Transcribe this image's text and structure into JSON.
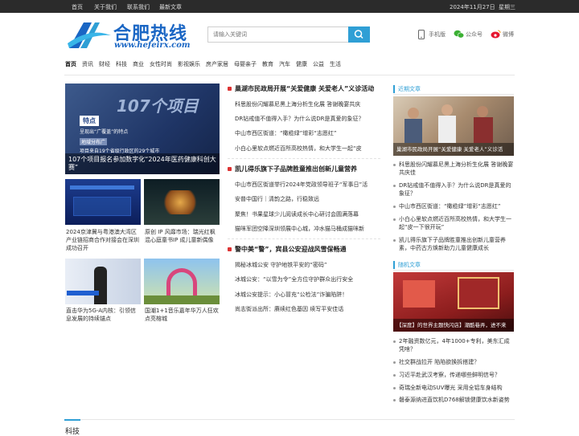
{
  "topbar": {
    "links": [
      "首页",
      "关于我们",
      "联系我们",
      "最新文章"
    ],
    "date": "2024年11月27日",
    "weekday": "星期三"
  },
  "header": {
    "logo_text": "合肥热线",
    "logo_url": "www.hefeirx.com",
    "search_placeholder": "请输入关键词",
    "mobile_label": "手机版",
    "wechat_label": "公众号",
    "weibo_label": "微博"
  },
  "nav": [
    "首页",
    "资讯",
    "财经",
    "科技",
    "商业",
    "女性时尚",
    "影视娱乐",
    "房产家居",
    "母婴亲子",
    "教育",
    "汽车",
    "健康",
    "公益",
    "生活"
  ],
  "featured": {
    "banner_big_text": "107个项目",
    "banner_box_title": "特点",
    "banner_box_sub": "呈现出“广覆盖”的特点",
    "banner_line1": "地域分布广",
    "banner_line2": "项目来自19个省级行政区的29个城市",
    "caption": "107个项目报名参加数字化“2024年医药健康科创大赛”"
  },
  "thumbs": [
    {
      "caption": "2024京津冀与粤港澳大湾区产业链招商合作对接会在深圳成功召开"
    },
    {
      "caption": "原创 IP 风靡市场：瑞光红枫混心庭童书IP 成儿童新偶像"
    },
    {
      "caption": "直击华为5G-A内核：引领信息发展的持续锚点"
    },
    {
      "caption": "国潮1+1音乐嘉年华万人狂欢点亮榕城"
    }
  ],
  "middle": [
    {
      "headline": "巢湖市民政局开展“关爱健康 关爱老人”义诊活动",
      "items": [
        "科思股份闪耀慕尼黑上海分析生化展 答谢晚宴共庆",
        "DR钻戒值不值得入手？为什么说DR是真爱的象征？",
        "中山市西区街道：“橄榄绿”增彩“志愿红”",
        "小白心里软点燃近百所高校热情，和大学生一起“皮"
      ]
    },
    {
      "headline": "凯儿得乐旗下子品牌胜童推出创新儿童营养",
      "items": [
        "中山市西区街道举行2024年党政领导班子“军事日”活",
        "安普中国行｜清韵之路，行稳致远",
        "聚焦！书果星球少儿阅读成长中心研讨会圆满落幕",
        "猫咪军团空降深圳领展中心城，冲水猫马桶成猫咪新"
      ]
    },
    {
      "headline": "警中美“警”，宾县公安迎战风雪保畅通",
      "items": [
        "揭秘冰城公安 守护地铁平安的“密码”",
        "冰城公安：“以雪为令”全方位守护群众出行安全",
        "冰城公安提示：小心冒充“公检法”诈骗陷阱！",
        "尚志街派出所：赓续红色基因 续写平安佳话"
      ]
    }
  ],
  "sidebar": {
    "recent_title": "近期文章",
    "recent_image_caption": "巢湖市民政局开展“关爱健康 关爱老人”义诊活",
    "recent_items": [
      "科思股份闪耀慕尼黑上海分析生化展 答谢晚宴共庆佳",
      "DR钻戒值不值得入手？为什么说DR是真爱的象征？",
      "中山市西区街道：“橄榄绿”增彩“志愿红”",
      "小白心里软点燃近百所高校热情，和大学生一起“皮一下很开玩”",
      "凯儿得乐旗下子品牌胜童推出创新儿童营养素，中药古方焕新助力儿童健康成长"
    ],
    "random_title": "随机文章",
    "random_image_caption": "【深度】的世界主题快闪店】潮酷巷弄，进不来",
    "random_items": [
      "2年融资数亿元，4年1000+专利，美东汇成凭啥？",
      "社交群战拉开 陷陷欲换拆搭建？",
      "习近平赴武汉考察，传递哪些鲜明信号？",
      "奇瑞全新电动SUV曝光 采用全铝车身结构",
      "磐泰源纳进直饮机D768解锁健康饮水新姿势"
    ]
  },
  "bottom_section": "科技"
}
